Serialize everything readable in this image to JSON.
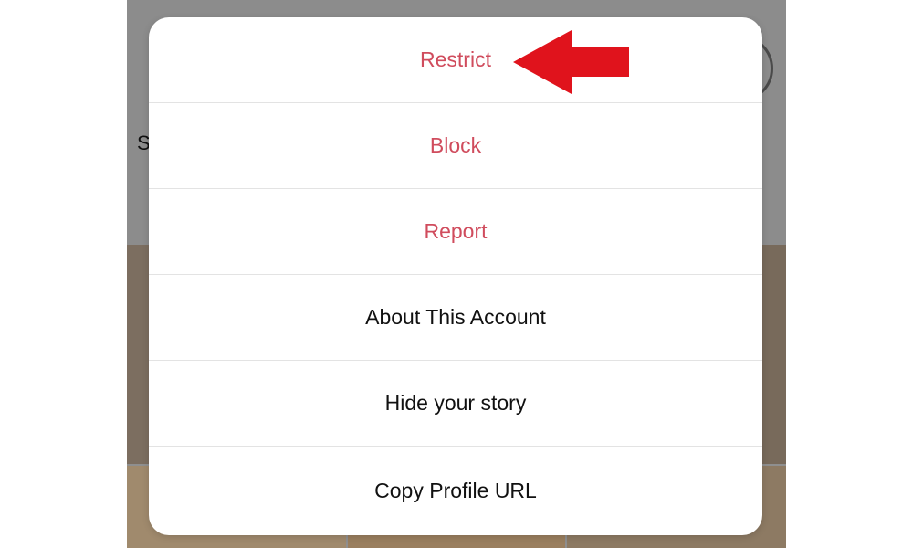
{
  "background": {
    "edge_glyph": "S"
  },
  "action_sheet": {
    "options": [
      {
        "label": "Restrict",
        "style": "destructive"
      },
      {
        "label": "Block",
        "style": "destructive"
      },
      {
        "label": "Report",
        "style": "destructive"
      },
      {
        "label": "About This Account",
        "style": "normal"
      },
      {
        "label": "Hide your story",
        "style": "normal"
      },
      {
        "label": "Copy Profile URL",
        "style": "normal"
      }
    ]
  },
  "annotation": {
    "arrow_target": "Restrict",
    "arrow_color": "#e0131c"
  },
  "colors": {
    "destructive": "#d04c5d",
    "normal_text": "#111111",
    "sheet_background": "#ffffff",
    "overlay": "#8f8f8f"
  }
}
